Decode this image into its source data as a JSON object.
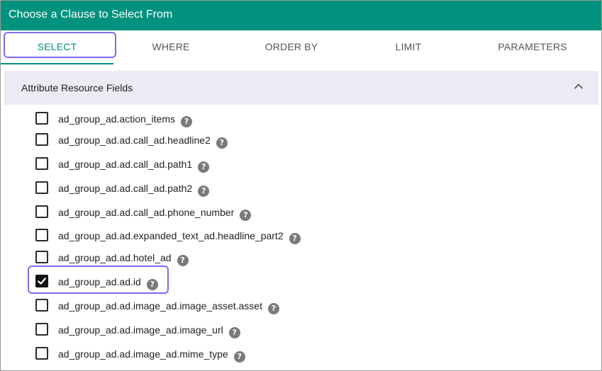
{
  "dialog": {
    "title": "Choose a Clause to Select From"
  },
  "tabs": [
    {
      "label": "SELECT",
      "active": true
    },
    {
      "label": "WHERE",
      "active": false
    },
    {
      "label": "ORDER BY",
      "active": false
    },
    {
      "label": "LIMIT",
      "active": false
    },
    {
      "label": "PARAMETERS",
      "active": false
    }
  ],
  "section": {
    "title": "Attribute Resource Fields",
    "expanded": true,
    "chevron_icon": "chevron-up-icon"
  },
  "fields": [
    {
      "label": "ad_group_ad.action_items",
      "checked": false
    },
    {
      "label": "ad_group_ad.ad.call_ad.headline2",
      "checked": false
    },
    {
      "label": "ad_group_ad.ad.call_ad.path1",
      "checked": false
    },
    {
      "label": "ad_group_ad.ad.call_ad.path2",
      "checked": false
    },
    {
      "label": "ad_group_ad.ad.call_ad.phone_number",
      "checked": false
    },
    {
      "label": "ad_group_ad.ad.expanded_text_ad.headline_part2",
      "checked": false
    },
    {
      "label": "ad_group_ad.ad.hotel_ad",
      "checked": false
    },
    {
      "label": "ad_group_ad.ad.id",
      "checked": true
    },
    {
      "label": "ad_group_ad.ad.image_ad.image_asset.asset",
      "checked": false
    },
    {
      "label": "ad_group_ad.ad.image_ad.image_url",
      "checked": false
    },
    {
      "label": "ad_group_ad.ad.image_ad.mime_type",
      "checked": false
    }
  ],
  "help_icon_glyph": "?",
  "colors": {
    "header": "#00927e",
    "highlight": "#7b6cf0",
    "section_bg": "#ebebf4"
  }
}
